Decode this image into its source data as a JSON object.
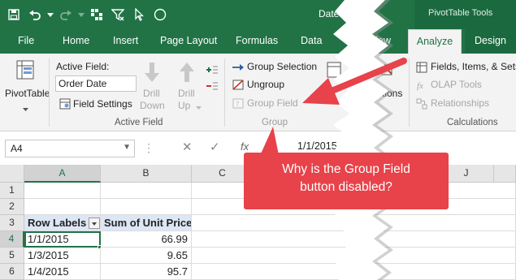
{
  "window": {
    "doc_title": "Dates",
    "context_tools_label": "PivotTable Tools"
  },
  "qat": {
    "icons": [
      "save-icon",
      "undo-icon",
      "undo-dropdown-icon",
      "redo-icon",
      "redo-dropdown-icon",
      "pivot-icon",
      "filter-icon",
      "select-pointer-icon",
      "circle-shape-icon"
    ]
  },
  "tabs": [
    {
      "label": "File"
    },
    {
      "label": "Home"
    },
    {
      "label": "Insert"
    },
    {
      "label": "Page Layout"
    },
    {
      "label": "Formulas"
    },
    {
      "label": "Data"
    },
    {
      "label": "Review"
    },
    {
      "label": "Analyze",
      "active": true
    },
    {
      "label": "Design"
    }
  ],
  "ribbon": {
    "pivottable": {
      "label": "PivotTable"
    },
    "active_field": {
      "title": "Active Field:",
      "value": "Order Date",
      "field_settings": "Field Settings",
      "drill_down": [
        "Drill",
        "Down"
      ],
      "drill_up": [
        "Drill",
        "Up"
      ],
      "group_label": "Active Field"
    },
    "group": {
      "group_selection": "Group Selection",
      "ungroup": "Ungroup",
      "group_field": "Group Field",
      "group_field_enabled": false,
      "group_label": "Group"
    },
    "insert": {
      "partial_label": "ctions"
    },
    "calculations": {
      "fields_items_sets": "Fields, Items, & Sets",
      "olap_tools": "OLAP Tools",
      "relationships": "Relationships",
      "group_label": "Calculations"
    }
  },
  "formula_bar": {
    "name_box": "A4",
    "fx": "fx",
    "value": "1/1/2015"
  },
  "sheet": {
    "columns": [
      "A",
      "B",
      "C",
      "J"
    ],
    "rows": [
      {
        "row": "1",
        "a": "",
        "b": ""
      },
      {
        "row": "2",
        "a": "",
        "b": ""
      },
      {
        "row": "3",
        "a": "Row Labels",
        "b": "Sum of Unit Price",
        "header": true
      },
      {
        "row": "4",
        "a": "1/1/2015",
        "b": "66.99",
        "active": true
      },
      {
        "row": "5",
        "a": "1/3/2015",
        "b": "9.65"
      },
      {
        "row": "6",
        "a": "1/4/2015",
        "b": "95.7"
      }
    ],
    "active_cell": "A4"
  },
  "callout": {
    "line1": "Why is the Group Field",
    "line2": "button disabled?",
    "color": "#e8424a"
  },
  "colors": {
    "excel_green": "#217346",
    "ribbon_bg": "#f3f3f3",
    "pivot_header_fill": "#dde6f4",
    "arrow_red": "#e8424a"
  }
}
